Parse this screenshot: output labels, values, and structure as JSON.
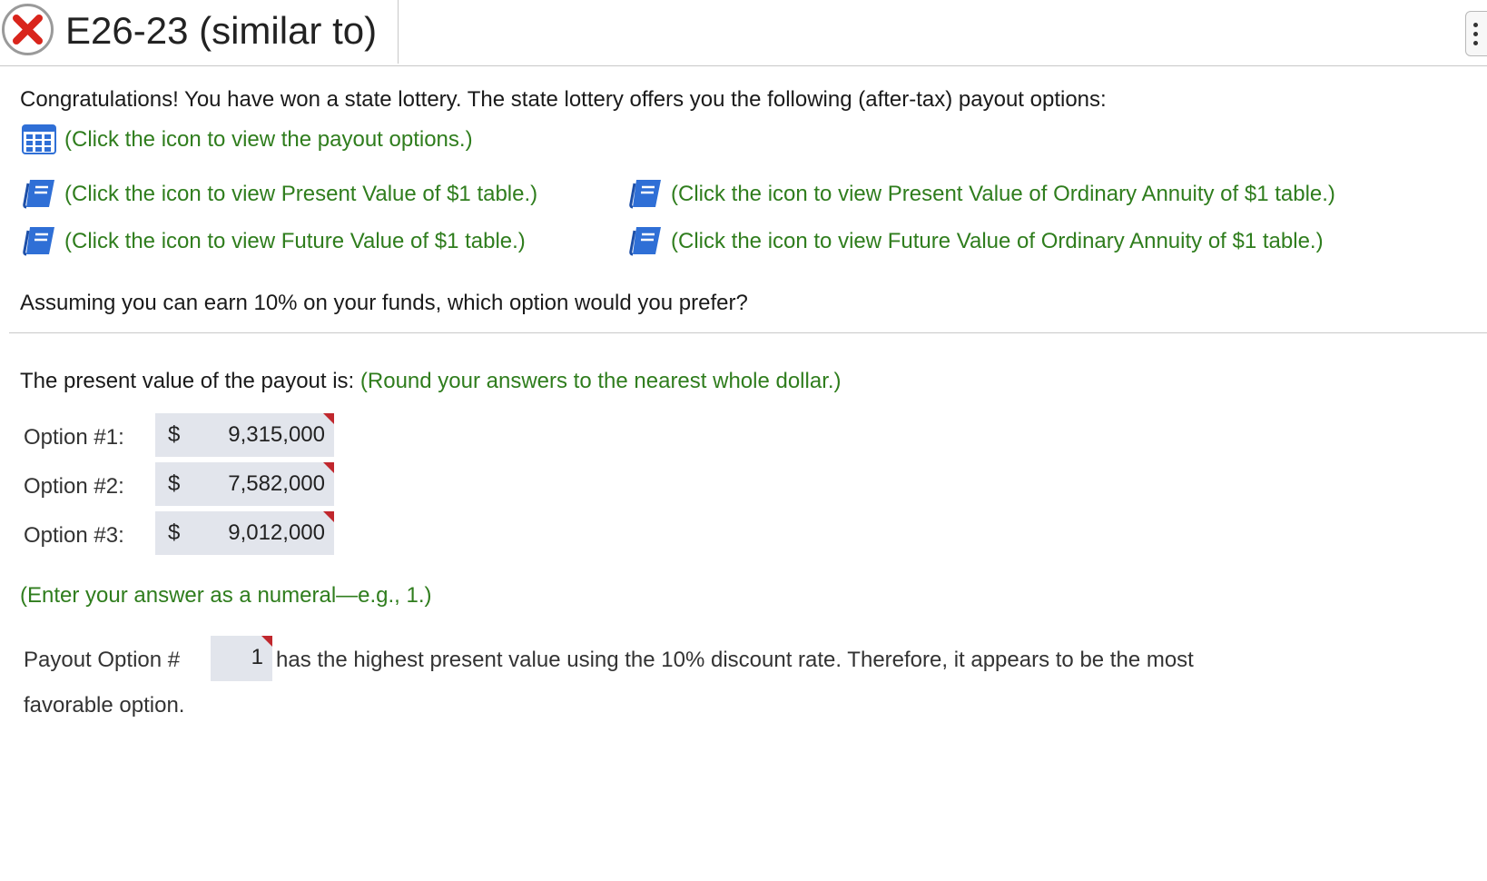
{
  "header": {
    "title": "E26-23 (similar to)",
    "status_icon": "x-circle-icon",
    "status_color": "#d9251c"
  },
  "question": {
    "intro": "Congratulations! You have won a state lottery. The state lottery offers you the following (after-tax) payout options:",
    "payout_link": "(Click the icon to view the payout options.)",
    "pv_table_link": "(Click the icon to view Present Value of $1 table.)",
    "pv_annuity_link": "(Click the icon to view Present Value of Ordinary Annuity of $1 table.)",
    "fv_table_link": "(Click the icon to view Future Value of $1 table.)",
    "fv_annuity_link": "(Click the icon to view Future Value of Ordinary Annuity of $1 table.)",
    "prompt": "Assuming you can earn 10% on your funds, which option would you prefer?"
  },
  "answer": {
    "pv_intro": "The present value of the payout is:",
    "pv_instruction": "(Round your answers to the nearest whole dollar.)",
    "currency": "$",
    "options": [
      {
        "label": "Option #1:",
        "value": "9,315,000"
      },
      {
        "label": "Option #2:",
        "value": "7,582,000"
      },
      {
        "label": "Option #3:",
        "value": "9,012,000"
      }
    ],
    "numeral_instruction": "(Enter your answer as a numeral—e.g., 1.)",
    "payout_prefix": "Payout Option #",
    "payout_value": "1",
    "payout_suffix": "has the highest present value using the 10% discount rate. Therefore, it appears to be the most",
    "payout_suffix_line2": "favorable option."
  },
  "colors": {
    "link_green": "#2f7d1d",
    "book_blue": "#2f6fd6",
    "input_bg": "#e2e5ec",
    "incorrect_flag": "#c0272d"
  }
}
